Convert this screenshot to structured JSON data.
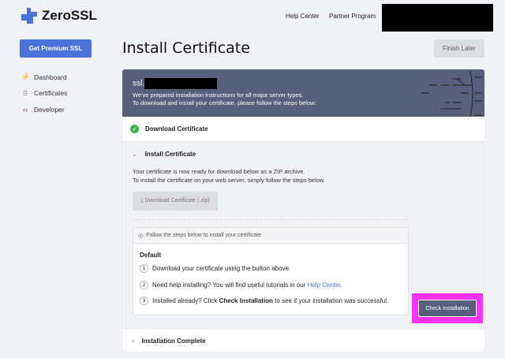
{
  "header": {
    "brand": "ZeroSSL",
    "nav": [
      "Help Center",
      "Partner Program"
    ]
  },
  "sidebar": {
    "premium_button": "Get Premium SSL",
    "items": [
      {
        "label": "Dashboard",
        "icon": "bolt-icon"
      },
      {
        "label": "Certificates",
        "icon": "grid-icon"
      },
      {
        "label": "Developer",
        "icon": "code-icon"
      }
    ]
  },
  "page": {
    "title": "Install Certificate",
    "finish_later": "Finish Later"
  },
  "banner": {
    "domain_prefix": "ssl.",
    "line1": "We've prepared installation instructions for all major server types.",
    "line2": "To download and install your certificate, please follow the steps below:"
  },
  "steps": {
    "download": "Download Certificate",
    "install": "Install Certificate",
    "complete": "Installation Complete"
  },
  "install": {
    "text1": "Your certificate is now ready for download below as a ZIP archive.",
    "text2": "To install the certificate on your web server, simply follow the steps below.",
    "download_button": "Download Certificate (.zip)",
    "box_header": "Follow the steps below to install your certificate",
    "box_title": "Default",
    "s1": "Download your certificate using the button above.",
    "s2_pre": "Need help installing? You will find useful tutorials in our ",
    "s2_link": "Help Center",
    "s2_post": ".",
    "s3_pre": "Installed already? Click ",
    "s3_bold": "Check Installation",
    "s3_post": " to see if your installation was successful.",
    "check_button": "Check Installation"
  },
  "colors": {
    "accent": "#4a72d9",
    "banner": "#56607c",
    "highlight": "#ff33ff"
  }
}
